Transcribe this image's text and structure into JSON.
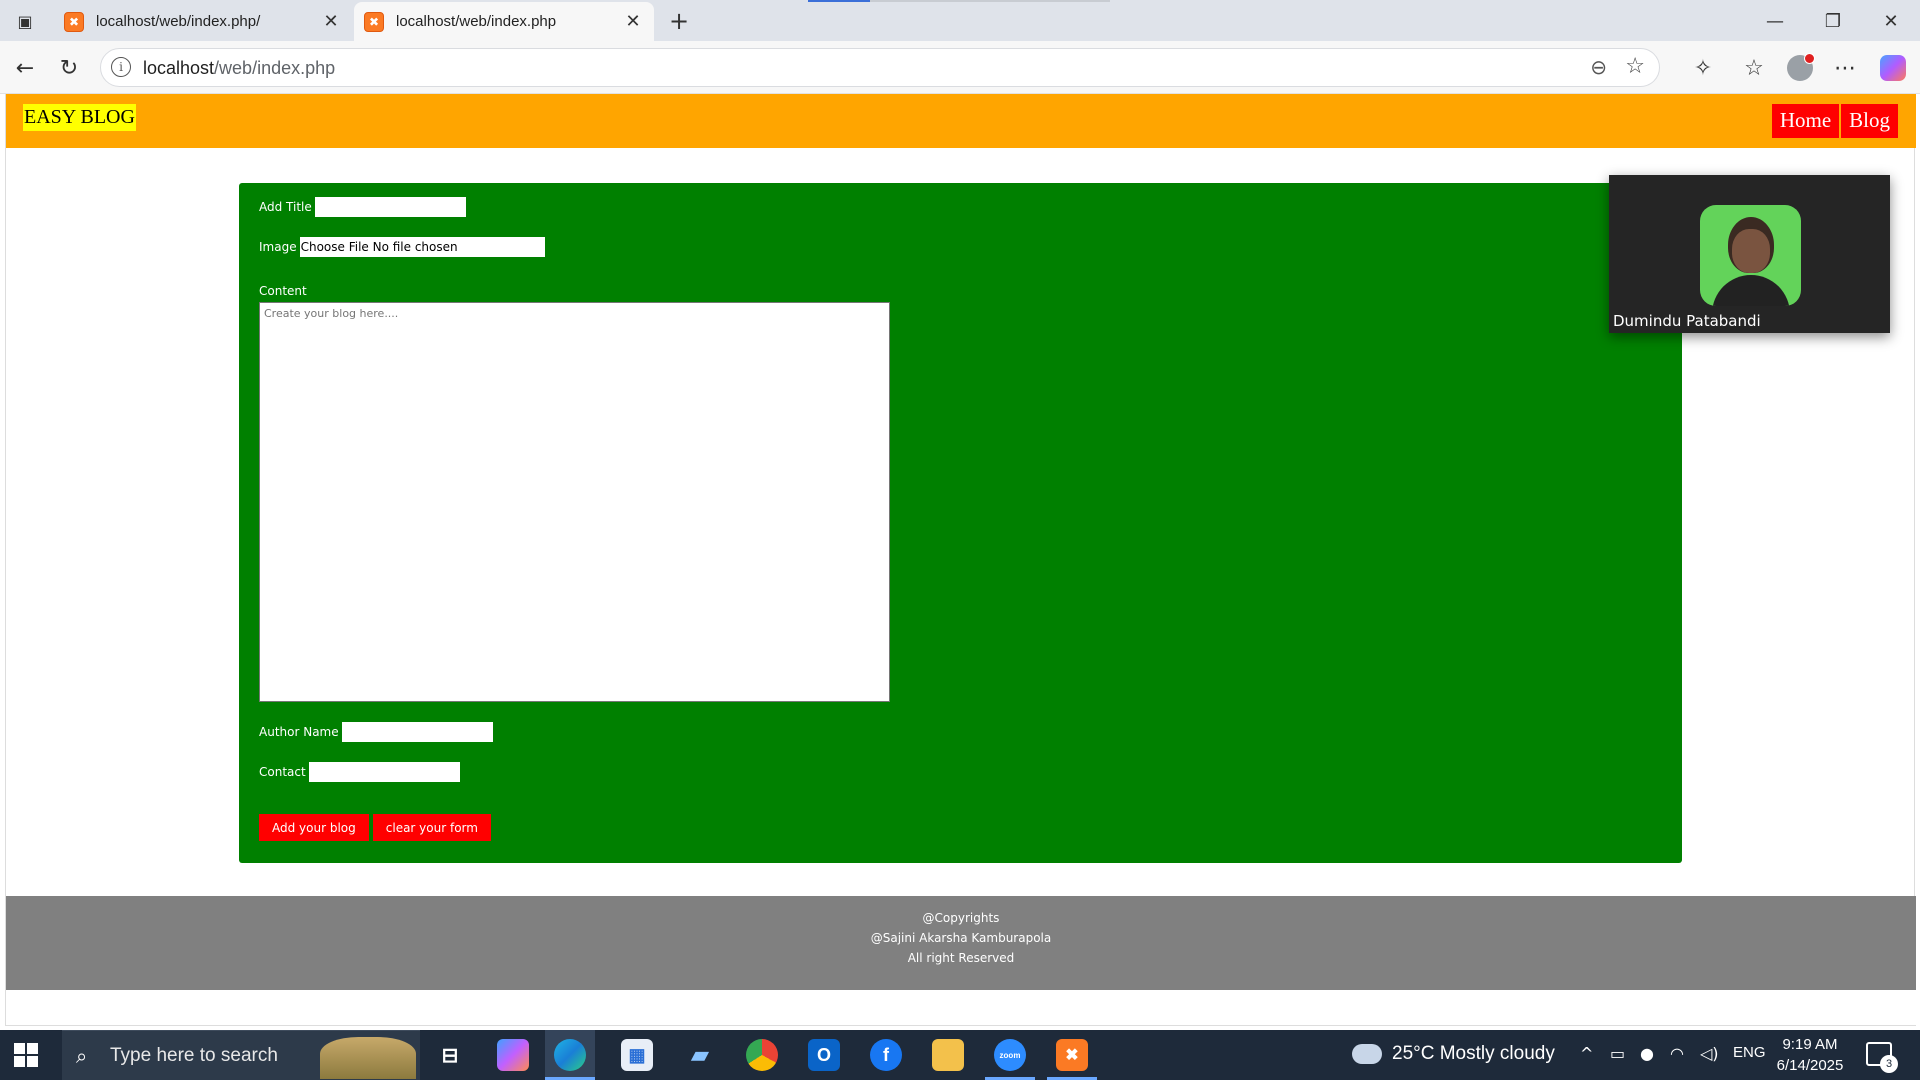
{
  "browser": {
    "tabs": [
      {
        "title": "localhost/web/index.php/",
        "favicon": "xampp-icon",
        "active": false
      },
      {
        "title": "localhost/web/index.php",
        "favicon": "xampp-icon",
        "active": true
      }
    ],
    "address": {
      "host": "localhost",
      "path": "/web/index.php"
    }
  },
  "site": {
    "brand": "EASY BLOG",
    "nav": {
      "home": "Home",
      "blog": "Blog"
    },
    "form": {
      "title_label": "Add Title",
      "image_label": "Image",
      "file_input_text": "Choose File No file chosen",
      "content_label": "Content",
      "content_placeholder": "Create your blog here....",
      "author_label": "Author Name",
      "contact_label": "Contact",
      "submit_label": "Add your blog",
      "clear_label": "clear your form"
    },
    "footer": {
      "line1": "@Copyrights",
      "line2": "@Sajini Akarsha Kamburapola",
      "line3": "All right Reserved"
    },
    "colors": {
      "header": "#ffa500",
      "brand_bg": "#ffff00",
      "nav_bg": "#ff0000",
      "form_bg": "#008000",
      "button_bg": "#ff0000",
      "footer_bg": "#808080"
    }
  },
  "video_overlay": {
    "participant_name": "Dumindu Patabandi"
  },
  "taskbar": {
    "search_placeholder": "Type here to search",
    "weather": "25°C  Mostly cloudy",
    "language": "ENG",
    "time": "9:19 AM",
    "date": "6/14/2025",
    "notification_count": "3",
    "apps": [
      "task-view-icon",
      "copilot-icon",
      "edge-icon",
      "store-icon",
      "laptop-icon",
      "chrome-icon",
      "outlook-icon",
      "facebook-icon",
      "file-explorer-icon",
      "zoom-icon",
      "xampp-icon"
    ]
  }
}
